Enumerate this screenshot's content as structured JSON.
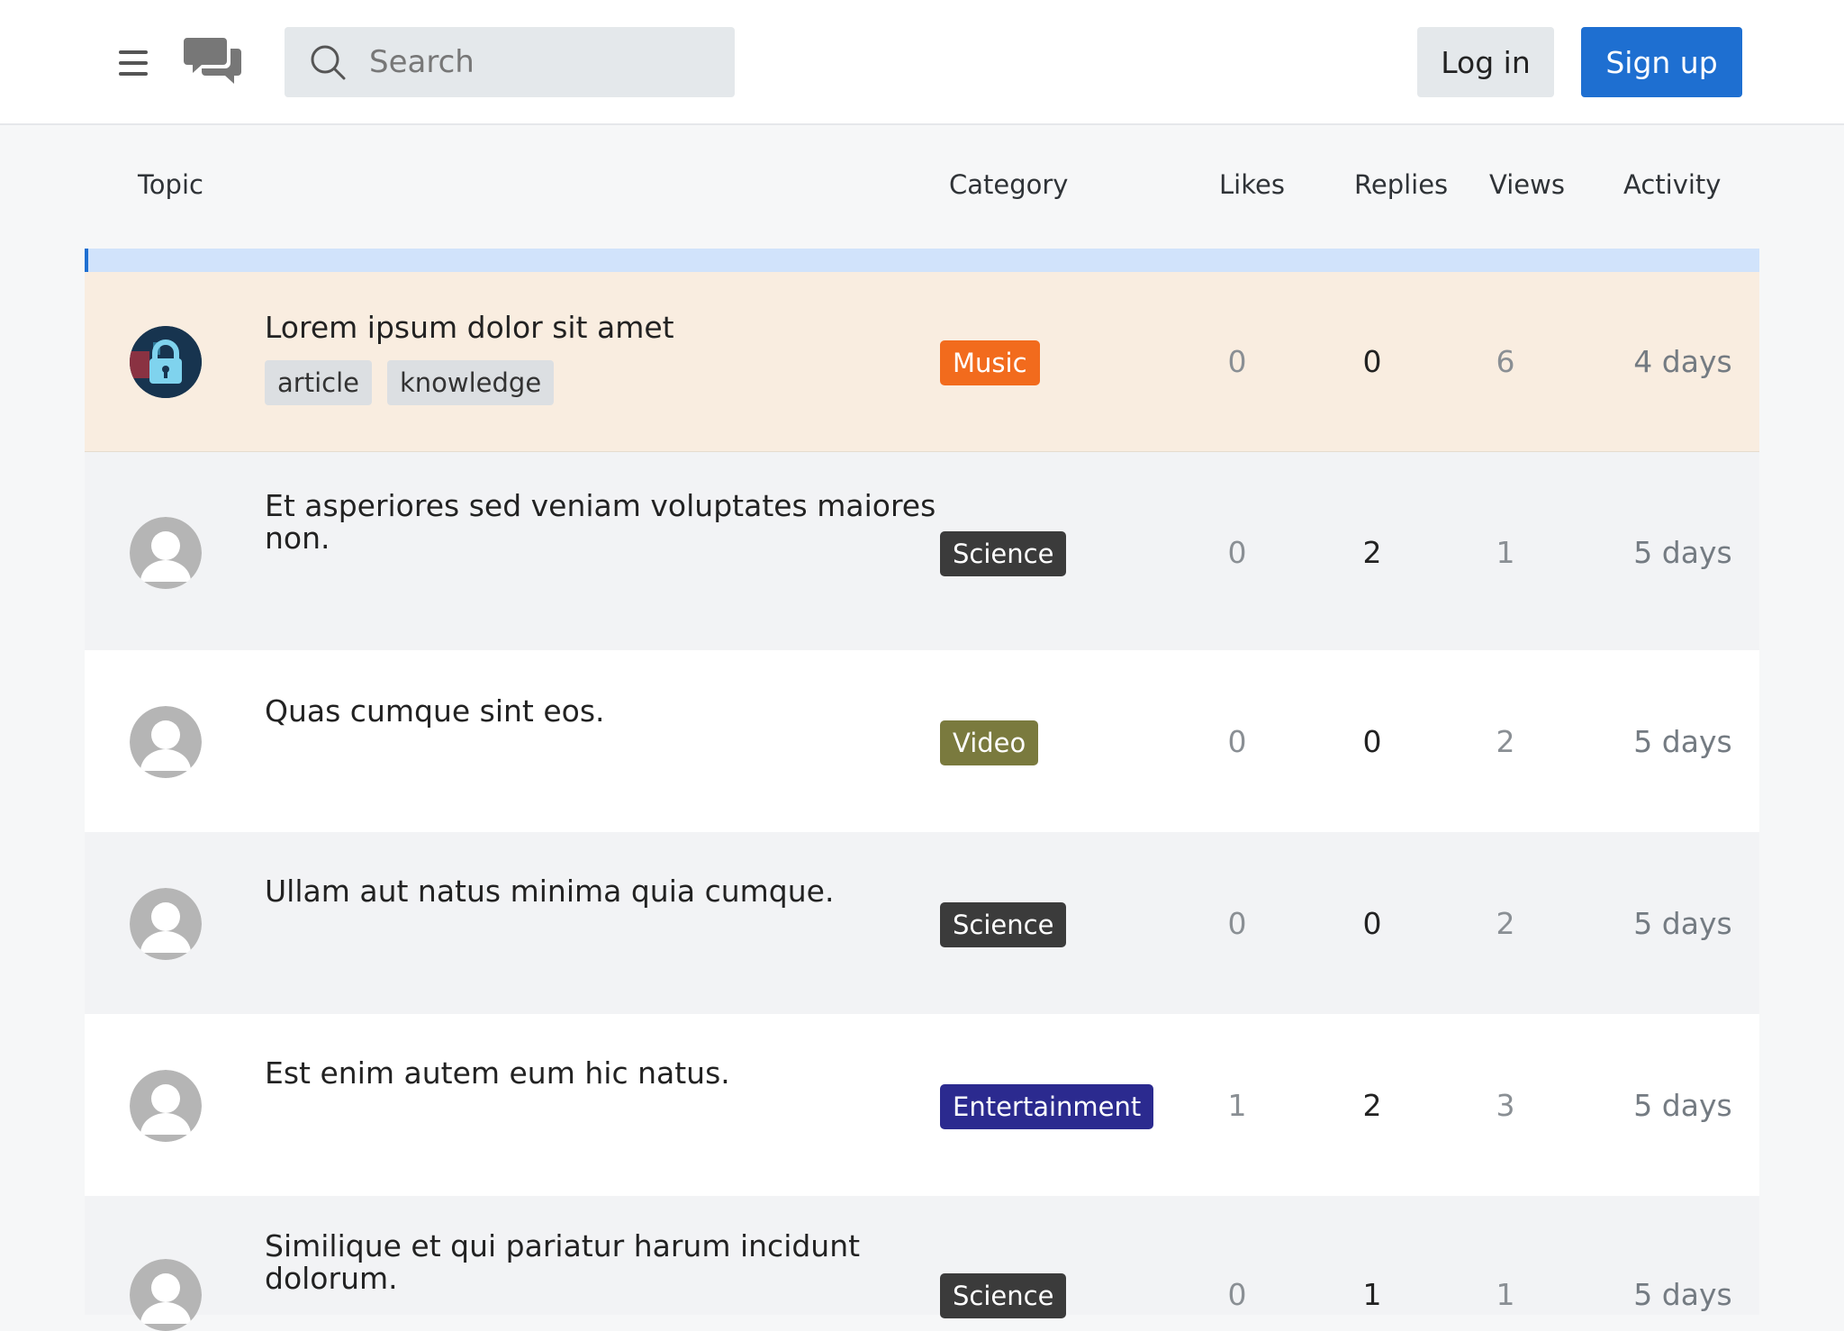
{
  "header": {
    "menu_icon": "hamburger-menu-icon",
    "logo_icon": "chat-bubbles-icon",
    "search": {
      "placeholder": "Search",
      "icon": "search-icon"
    },
    "login_label": "Log in",
    "signup_label": "Sign up",
    "signup_color": "#1e6fd1"
  },
  "table": {
    "columns": {
      "topic": "Topic",
      "category": "Category",
      "likes": "Likes",
      "replies": "Replies",
      "views": "Views",
      "activity": "Activity"
    },
    "rows": [
      {
        "title": "Lorem ipsum dolor sit amet",
        "tags": [
          "article",
          "knowledge"
        ],
        "category": "Music",
        "category_color": "#f26b1d",
        "likes": "0",
        "replies": "0",
        "views": "6",
        "activity": "4 days",
        "avatar": "lock-avatar-image"
      },
      {
        "title": "Et asperiores sed veniam voluptates maiores non.",
        "tags": [],
        "category": "Science",
        "category_color": "#3b3b3b",
        "likes": "0",
        "replies": "2",
        "views": "1",
        "activity": "5 days",
        "avatar": "default-avatar-icon"
      },
      {
        "title": "Quas cumque sint eos.",
        "tags": [],
        "category": "Video",
        "category_color": "#7a7a3e",
        "likes": "0",
        "replies": "0",
        "views": "2",
        "activity": "5 days",
        "avatar": "default-avatar-icon"
      },
      {
        "title": "Ullam aut natus minima quia cumque.",
        "tags": [],
        "category": "Science",
        "category_color": "#3b3b3b",
        "likes": "0",
        "replies": "0",
        "views": "2",
        "activity": "5 days",
        "avatar": "default-avatar-icon"
      },
      {
        "title": "Est enim autem eum hic natus.",
        "tags": [],
        "category": "Entertainment",
        "category_color": "#2b2a8f",
        "likes": "1",
        "replies": "2",
        "views": "3",
        "activity": "5 days",
        "avatar": "default-avatar-icon"
      },
      {
        "title": "Similique et qui pariatur harum incidunt dolorum.",
        "tags": [],
        "category": "Science",
        "category_color": "#3b3b3b",
        "likes": "0",
        "replies": "1",
        "views": "1",
        "activity": "5 days",
        "avatar": "default-avatar-icon"
      }
    ]
  }
}
